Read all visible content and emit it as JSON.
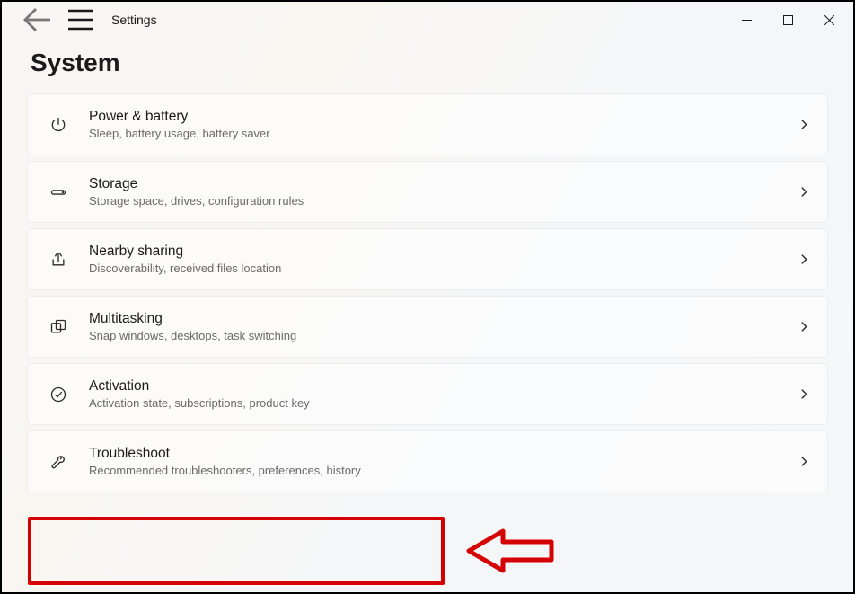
{
  "app": {
    "name": "Settings"
  },
  "page": {
    "title": "System"
  },
  "items": [
    {
      "id": "power",
      "title": "Power & battery",
      "sub": "Sleep, battery usage, battery saver"
    },
    {
      "id": "storage",
      "title": "Storage",
      "sub": "Storage space, drives, configuration rules"
    },
    {
      "id": "nearby",
      "title": "Nearby sharing",
      "sub": "Discoverability, received files location"
    },
    {
      "id": "multitask",
      "title": "Multitasking",
      "sub": "Snap windows, desktops, task switching"
    },
    {
      "id": "activation",
      "title": "Activation",
      "sub": "Activation state, subscriptions, product key"
    },
    {
      "id": "troubleshoot",
      "title": "Troubleshoot",
      "sub": "Recommended troubleshooters, preferences, history"
    }
  ],
  "annotation": {
    "highlighted_item_index": 5
  }
}
